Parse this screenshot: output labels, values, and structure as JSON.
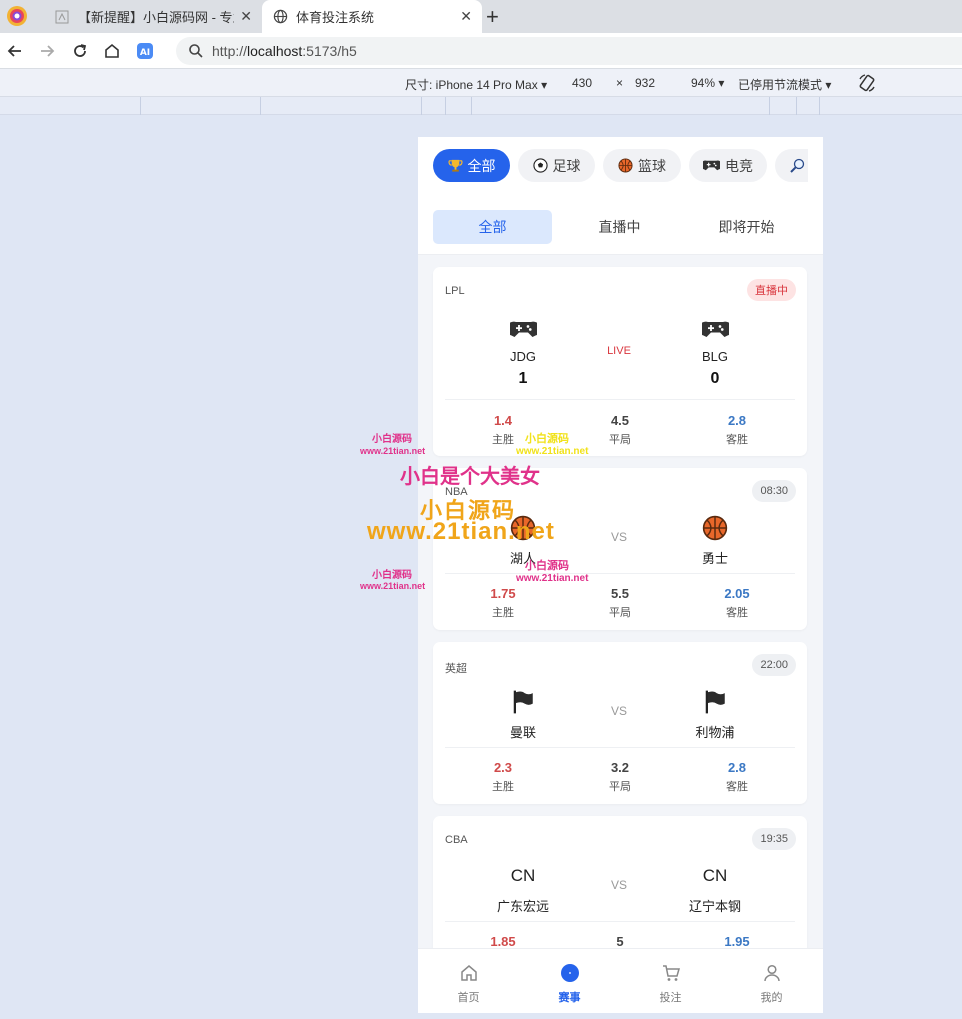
{
  "browser": {
    "tabs": [
      {
        "title": "【新提醒】小白源码网 - 专业",
        "active": false
      },
      {
        "title": "体育投注系统",
        "active": true
      }
    ],
    "url_scheme": "http://",
    "url_host": "localhost",
    "url_rest": ":5173/h5",
    "device_toolbar": {
      "size_label": "尺寸: iPhone 14 Pro Max",
      "width": "430",
      "times": "×",
      "height": "932",
      "zoom": "94%",
      "throttle": "已停用节流模式"
    }
  },
  "app": {
    "categories": [
      {
        "label": "全部",
        "icon": "trophy-icon",
        "active": true
      },
      {
        "label": "足球",
        "icon": "soccer-ball-icon",
        "active": false
      },
      {
        "label": "篮球",
        "icon": "basketball-icon",
        "active": false
      },
      {
        "label": "电竞",
        "icon": "gamepad-icon",
        "active": false
      },
      {
        "label": "",
        "icon": "racket-icon",
        "active": false
      }
    ],
    "status_tabs": [
      {
        "label": "全部",
        "active": true
      },
      {
        "label": "直播中",
        "active": false
      },
      {
        "label": "即将开始",
        "active": false
      }
    ],
    "matches": [
      {
        "league": "LPL",
        "badge": "直播中",
        "live": true,
        "home": {
          "name": "JDG",
          "score": "1",
          "icon": "gamepad-icon"
        },
        "away": {
          "name": "BLG",
          "score": "0",
          "icon": "gamepad-icon"
        },
        "mid": "LIVE",
        "odds": {
          "home": "1.4",
          "draw": "4.5",
          "away": "2.8"
        }
      },
      {
        "league": "NBA",
        "badge": "08:30",
        "live": false,
        "home": {
          "name": "湖人",
          "icon": "basketball-icon"
        },
        "away": {
          "name": "勇士",
          "icon": "basketball-icon"
        },
        "mid": "VS",
        "odds": {
          "home": "1.75",
          "draw": "5.5",
          "away": "2.05"
        }
      },
      {
        "league": "英超",
        "badge": "22:00",
        "live": false,
        "home": {
          "name": "曼联",
          "icon": "flag-icon"
        },
        "away": {
          "name": "利物浦",
          "icon": "flag-icon"
        },
        "mid": "VS",
        "odds": {
          "home": "2.3",
          "draw": "3.2",
          "away": "2.8"
        }
      },
      {
        "league": "CBA",
        "badge": "19:35",
        "live": false,
        "home": {
          "name": "广东宏远",
          "logo_text": "CN"
        },
        "away": {
          "name": "辽宁本钢",
          "logo_text": "CN"
        },
        "mid": "VS",
        "odds": {
          "home": "1.85",
          "draw": "5",
          "away": "1.95"
        }
      }
    ],
    "odds_labels": {
      "home": "主胜",
      "draw": "平局",
      "away": "客胜"
    },
    "bottom_nav": [
      {
        "label": "首页",
        "icon": "home-icon",
        "active": false
      },
      {
        "label": "赛事",
        "icon": "events-icon",
        "active": true
      },
      {
        "label": "投注",
        "icon": "cart-icon",
        "active": false
      },
      {
        "label": "我的",
        "icon": "user-icon",
        "active": false
      }
    ]
  },
  "watermark": {
    "small_name": "小白源码",
    "small_url": "www.21tian.net",
    "title": "小白是个大美女",
    "big_name": "小白源码",
    "big_url": "www.21tian.net"
  },
  "colors": {
    "accent": "#2563eb",
    "live": "#d9363e",
    "home_odd": "#d04a4a",
    "away_odd": "#3b78c4"
  }
}
